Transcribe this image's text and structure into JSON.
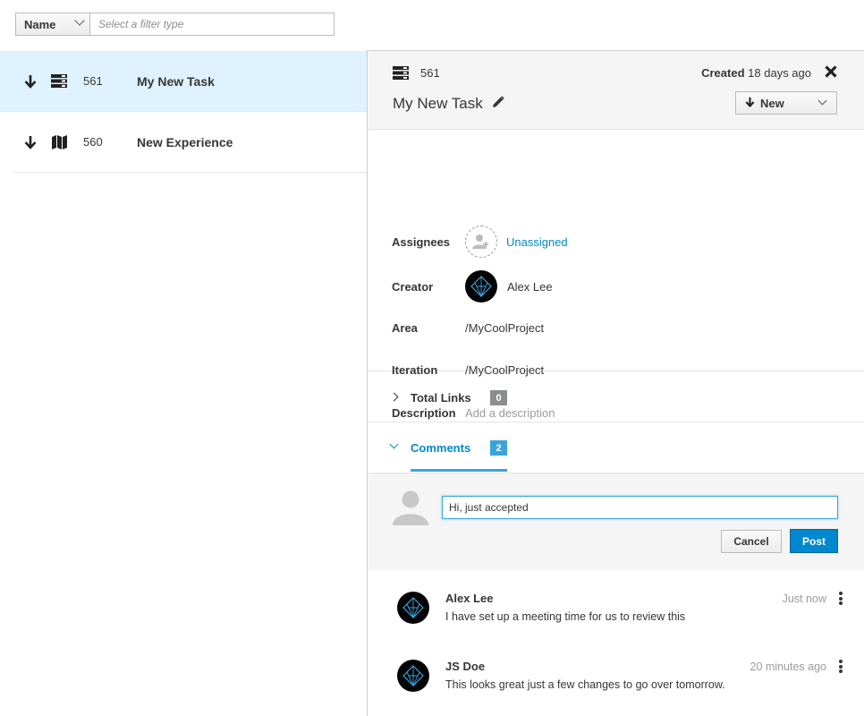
{
  "filter": {
    "select_label": "Name",
    "placeholder": "Select a filter type"
  },
  "list": {
    "items": [
      {
        "number": "561",
        "title": "My New Task",
        "type_icon": "task-icon",
        "priority_icon": "arrow-down-icon"
      },
      {
        "number": "560",
        "title": "New Experience",
        "type_icon": "map-icon",
        "priority_icon": "arrow-down-icon"
      }
    ]
  },
  "detail": {
    "number": "561",
    "created_label": "Created",
    "created_value": "18 days ago",
    "title": "My New Task",
    "state": "New",
    "fields": {
      "assignees_label": "Assignees",
      "assignees_value": "Unassigned",
      "creator_label": "Creator",
      "creator_value": "Alex Lee",
      "area_label": "Area",
      "area_value": "/MyCoolProject",
      "iteration_label": "Iteration",
      "iteration_value": "/MyCoolProject",
      "description_label": "Description",
      "description_placeholder": "Add a description"
    },
    "links": {
      "label": "Total Links",
      "count": "0"
    },
    "comments": {
      "label": "Comments",
      "count": "2",
      "input_value": "Hi, just accepted",
      "cancel_label": "Cancel",
      "post_label": "Post",
      "items": [
        {
          "author": "Alex Lee",
          "time": "Just now",
          "text": "I have set up a meeting time for us to review this"
        },
        {
          "author": "JS Doe",
          "time": "20 minutes ago",
          "text": "This looks great just a few changes to go over tomorrow."
        }
      ]
    }
  },
  "colors": {
    "accent": "#0088ce",
    "selected_row": "#def3ff",
    "badge_blue": "#39a5dc",
    "badge_grey": "#8b8d8f"
  }
}
